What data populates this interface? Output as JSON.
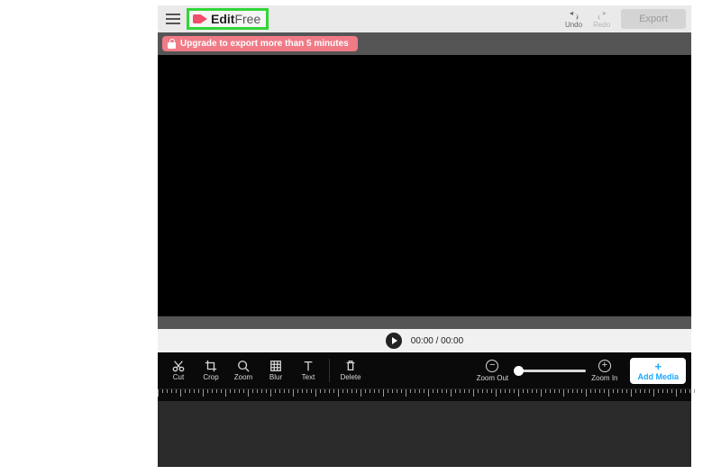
{
  "header": {
    "logo_bold": "Edit",
    "logo_thin": "Free",
    "undo_label": "Undo",
    "redo_label": "Redo",
    "export_label": "Export"
  },
  "banner": {
    "text": "Upgrade to export more than 5 minutes"
  },
  "playback": {
    "time_display": "00:00 / 00:00"
  },
  "tools": {
    "cut": "Cut",
    "crop": "Crop",
    "zoom": "Zoom",
    "blur": "Blur",
    "text": "Text",
    "delete": "Delete",
    "zoom_out": "Zoom Out",
    "zoom_in": "Zoom In",
    "add_media": "Add Media"
  }
}
